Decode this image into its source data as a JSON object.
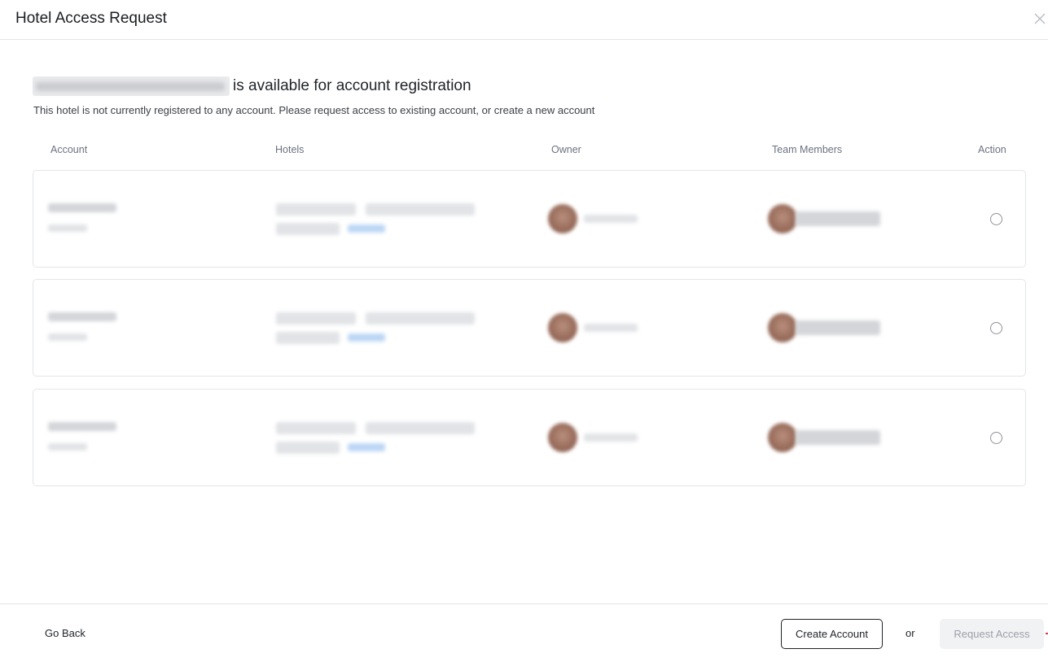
{
  "dialog": {
    "title": "Hotel Access Request",
    "close_icon": "close-icon"
  },
  "intro": {
    "headline_suffix": "is available for account registration",
    "subtext": "This hotel is not currently registered to any account. Please request access to existing account, or create a new account"
  },
  "table": {
    "headers": {
      "account": "Account",
      "hotels": "Hotels",
      "owner": "Owner",
      "team_members": "Team Members",
      "action": "Action"
    },
    "row_count": 3
  },
  "footer": {
    "go_back": "Go Back",
    "create_account": "Create Account",
    "or": "or",
    "request_access": "Request Access"
  },
  "colors": {
    "border": "#e3e5e8",
    "disabled_bg": "#f1f2f4",
    "disabled_text": "#9ca0a7",
    "accent_link": "#1a73e8"
  }
}
